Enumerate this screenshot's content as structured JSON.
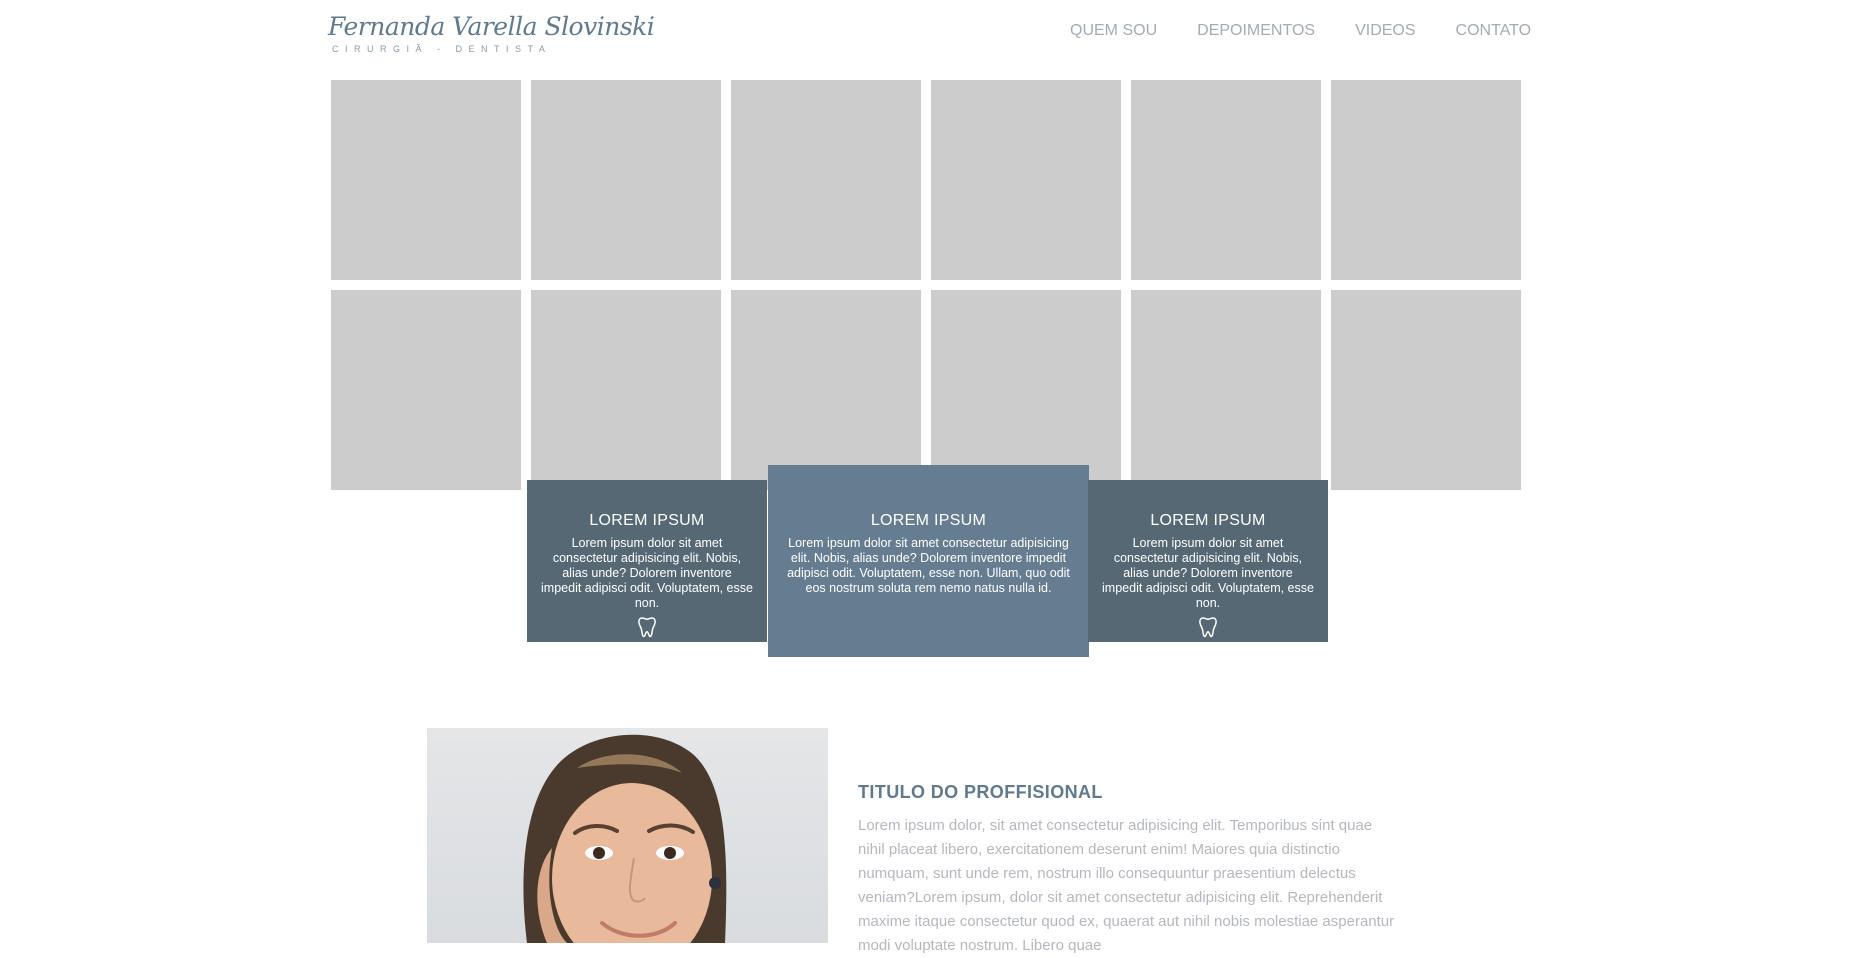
{
  "header": {
    "logo_name": "Fernanda Varella Slovinski",
    "logo_subtitle": "CIRURGIÃ - DENTISTA",
    "nav": [
      "QUEM SOU",
      "DEPOIMENTOS",
      "VIDEOS",
      "CONTATO"
    ]
  },
  "cards": [
    {
      "title": "LOREM IPSUM",
      "text": "Lorem ipsum dolor sit amet consectetur adipisicing elit. Nobis, alias unde? Dolorem inventore impedit adipisci odit. Voluptatem, esse non.",
      "icon": "tooth-icon"
    },
    {
      "title": "LOREM IPSUM",
      "text": "Lorem ipsum dolor sit amet consectetur adipisicing elit. Nobis, alias unde? Dolorem inventore impedit adipisci odit. Voluptatem, esse non. Ullam, quo odit eos nostrum soluta rem nemo natus nulla id."
    },
    {
      "title": "LOREM IPSUM",
      "text": "Lorem ipsum dolor sit amet consectetur adipisicing elit. Nobis, alias unde? Dolorem inventore impedit adipisci odit. Voluptatem, esse non.",
      "icon": "tooth-icon"
    }
  ],
  "about": {
    "title": "TITULO DO PROFFISIONAL",
    "text": "Lorem ipsum dolor, sit amet consectetur adipisicing elit. Temporibus sint quae nihil placeat libero, exercitationem deserunt enim! Maiores quia distinctio numquam, sunt unde rem, nostrum illo consequuntur praesentium delectus veniam?Lorem ipsum, dolor sit amet consectetur adipisicing elit. Reprehenderit maxime itaque consectetur quod ex, quaerat aut nihil nobis molestiae asperantur modi voluptate nostrum. Libero quae"
  },
  "colors": {
    "accent": "#667d91",
    "card_dark": "#556873",
    "tile": "#cccccc",
    "nav_text": "#a3acb3"
  }
}
